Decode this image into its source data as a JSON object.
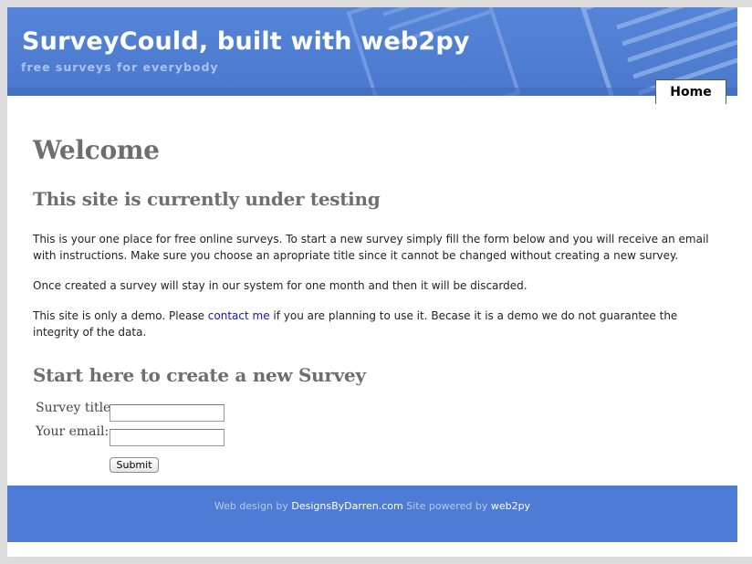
{
  "header": {
    "title": "SurveyCould, built with web2py",
    "tagline": "free surveys for everybody"
  },
  "nav": {
    "home_tab": "Home"
  },
  "content": {
    "welcome_heading": "Welcome",
    "testing_heading": "This site is currently under testing",
    "intro_paragraph": "This is your one place for free online surveys. To start a new survey simply fill the form below and you will receive an email with instructions. Make sure you choose an apropriate title since it cannot be changed without creating a new survey.",
    "lifetime_paragraph": "Once created a survey will stay in our system for one month and then it will be discarded.",
    "demo_paragraph": {
      "before_link": "This site is only a demo. Please ",
      "link_text": "contact me",
      "after_link": " if you are planning to use it. Becase it is a demo we do not guarantee the integrity of the data."
    },
    "create_heading": "Start here to create a new Survey"
  },
  "form": {
    "survey_title_label": "Survey title:",
    "survey_title_value": "",
    "email_label": "Your email:",
    "email_value": "",
    "submit_label": "Submit"
  },
  "footer": {
    "design_prefix": "Web design by ",
    "designer_link": "DesignsByDarren.com",
    "powered_prefix": " Site powered by ",
    "powered_link": "web2py"
  },
  "colors": {
    "header_blue": "#4b78cc",
    "footer_blue": "#4e7bd3",
    "heading_gray": "#6e6e6e",
    "link_blue": "#1414cc"
  }
}
